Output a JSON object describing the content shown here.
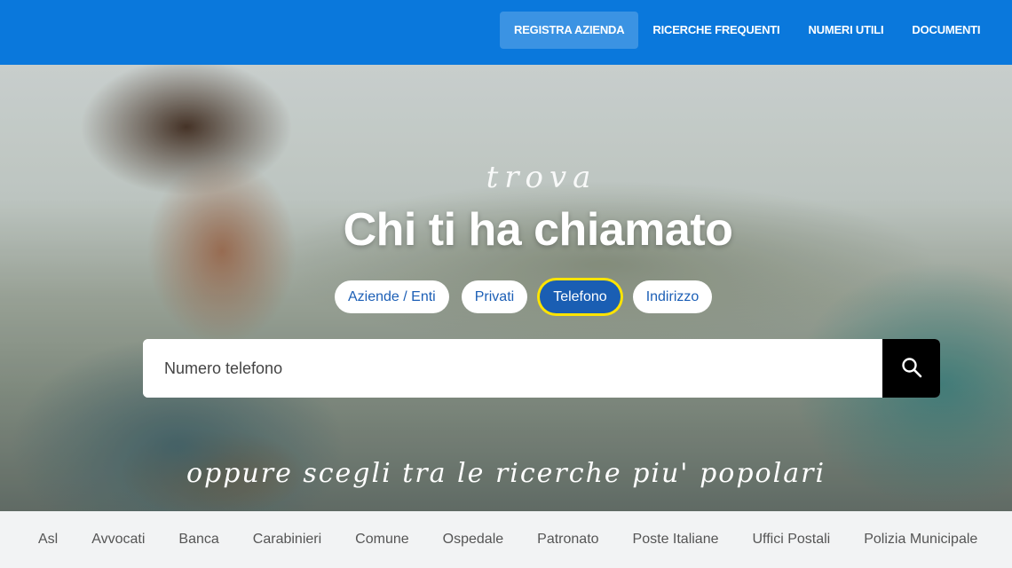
{
  "nav": {
    "items": [
      {
        "label": "REGISTRA AZIENDA",
        "active": true
      },
      {
        "label": "RICERCHE FREQUENTI",
        "active": false
      },
      {
        "label": "NUMERI UTILI",
        "active": false
      },
      {
        "label": "DOCUMENTI",
        "active": false
      }
    ]
  },
  "hero": {
    "script_top": "trova",
    "title": "Chi ti ha chiamato",
    "tabs": [
      {
        "label": "Aziende / Enti",
        "active": false
      },
      {
        "label": "Privati",
        "active": false
      },
      {
        "label": "Telefono",
        "active": true
      },
      {
        "label": "Indirizzo",
        "active": false
      }
    ],
    "search": {
      "placeholder": "Numero telefono",
      "value": "",
      "button_icon": "search-icon"
    },
    "script_bottom": "oppure scegli tra le ricerche piu' popolari"
  },
  "popular": {
    "items": [
      "Asl",
      "Avvocati",
      "Banca",
      "Carabinieri",
      "Comune",
      "Ospedale",
      "Patronato",
      "Poste Italiane",
      "Uffici Postali",
      "Polizia Municipale"
    ]
  },
  "colors": {
    "topbar": "#0a78dc",
    "active_tab": "#1a5eb3",
    "tab_text": "#1c5fb6",
    "highlight": "#ffe400",
    "search_button": "#000000"
  }
}
